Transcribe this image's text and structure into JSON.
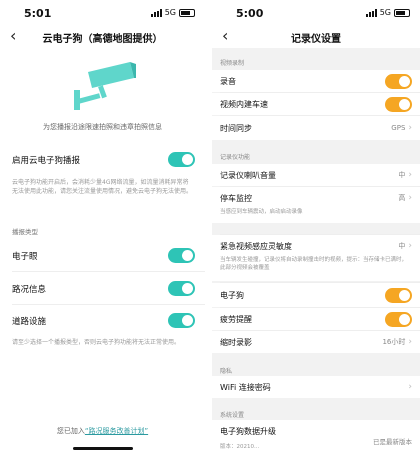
{
  "left": {
    "status": {
      "time": "5:01",
      "network": "5G"
    },
    "title": "云电子狗（高德地图提供）",
    "caption": "为您播报沿途限速拍照和违章拍照信息",
    "enable_label": "启用云电子狗播报",
    "enable_desc": "云电子狗功能开启后，会消耗少量4G网络流量，如流量消耗异常将无法使用此功能，请您关注流量使用情况，避免云电子狗无法使用。",
    "section_broadcast": "播报类型",
    "items": [
      {
        "label": "电子眼",
        "on": true
      },
      {
        "label": "路况信息",
        "on": true
      },
      {
        "label": "道路设施",
        "on": true
      }
    ],
    "bottom_desc": "请至少选择一个播报类型，否则云电子狗功能将无法正常使用。",
    "footer_prefix": "您已加入",
    "footer_link": "“路况服务改善计划”",
    "colors": {
      "toggle": "#2ec4b6"
    }
  },
  "right": {
    "status": {
      "time": "5:00",
      "network": "5G"
    },
    "title": "记录仪设置",
    "sec_video": "视频录制",
    "rec_sound": "录音",
    "video_speed": "视频内建车速",
    "time_sync": "时间同步",
    "time_sync_val": "GPS",
    "sec_recorder": "记录仪功能",
    "speaker_volume": "记录仪喇叭音量",
    "speaker_val": "中",
    "park_monitor": "停车监控",
    "park_val": "高",
    "park_desc": "当感应到车辆震动，启动启动录像",
    "emergency": "紧急视频感应灵敏度",
    "emergency_val": "中",
    "emergency_desc": "当车辆发生碰撞，记录仪将自动录制撞击时的视频，提示：当存储卡已满时，此部分视频会被覆盖",
    "e_dog": "电子狗",
    "fatigue": "疲劳提醒",
    "timelapse": "缩时录影",
    "timelapse_val": "16小时",
    "sec_privacy": "隐私",
    "wifi_pwd": "WiFi 连接密码",
    "sec_system": "系统设置",
    "edog_upgrade": "电子狗数据升级",
    "edog_version_label": "版本：20210...",
    "edog_latest": "已是最新版本",
    "colors": {
      "toggle": "#f5a623"
    }
  }
}
